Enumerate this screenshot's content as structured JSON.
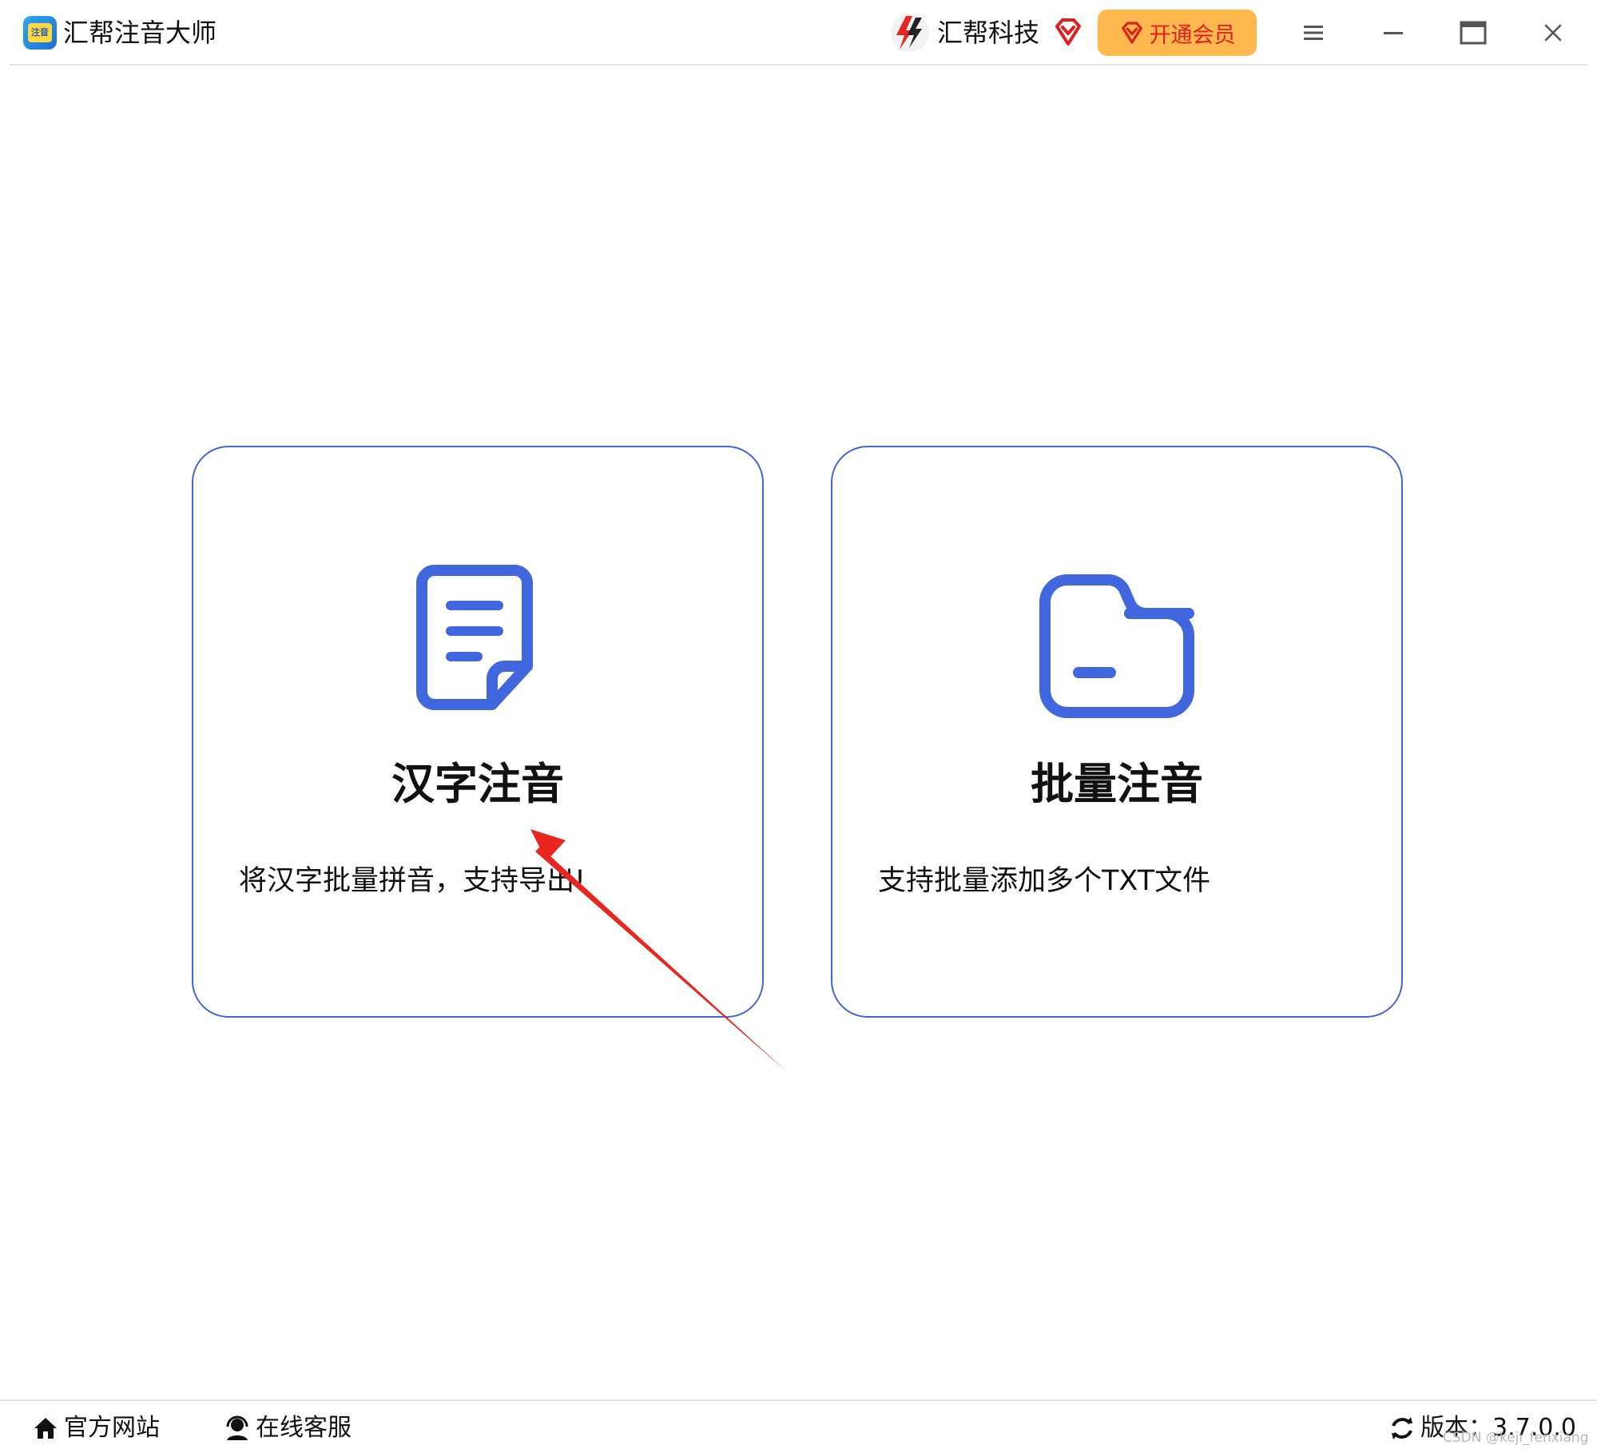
{
  "app": {
    "title": "汇帮注音大师",
    "logo_text": "注音"
  },
  "header": {
    "brand_name": "汇帮科技",
    "vip_button_label": "开通会员"
  },
  "colors": {
    "accent": "#3f66db",
    "icon_blue": "#4167de",
    "vip_bg": "#ffb84d",
    "vip_text": "#e02020",
    "arrow": "#e8251f"
  },
  "icons": {
    "menu": "hamburger-menu-icon",
    "minimize": "minimize-icon",
    "maximize": "maximize-icon",
    "close": "close-icon",
    "card_left": "document-icon",
    "card_right": "folder-icon",
    "home": "home-icon",
    "support": "customer-service-icon",
    "refresh": "refresh-icon"
  },
  "cards": [
    {
      "title": "汉字注音",
      "description": "将汉字批量拼音，支持导出!"
    },
    {
      "title": "批量注音",
      "description": "支持批量添加多个TXT文件"
    }
  ],
  "footer": {
    "website_label": "官方网站",
    "support_label": "在线客服",
    "version_label": "版本：3.7.0.0"
  },
  "watermark": "CSDN @keji_fenxiang"
}
